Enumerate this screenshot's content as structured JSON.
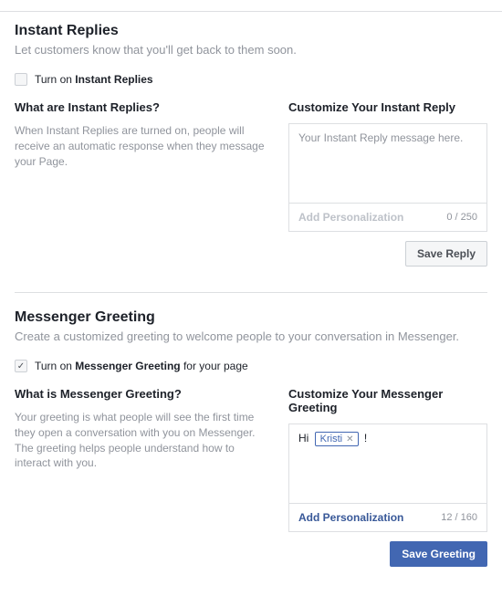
{
  "instant_replies": {
    "title": "Instant Replies",
    "subtitle": "Let customers know that you'll get back to them soon.",
    "checkbox_prefix": "Turn on ",
    "checkbox_bold": "Instant Replies",
    "checked": false,
    "left_heading": "What are Instant Replies?",
    "left_desc": "When Instant Replies are turned on, people will receive an automatic response when they message your Page.",
    "right_heading": "Customize Your Instant Reply",
    "textarea_placeholder": "Your Instant Reply message here.",
    "add_personalization_label": "Add Personalization",
    "char_count": "0 / 250",
    "save_button": "Save Reply"
  },
  "messenger_greeting": {
    "title": "Messenger Greeting",
    "subtitle": "Create a customized greeting to welcome people to your conversation in Messenger.",
    "checkbox_prefix": "Turn on ",
    "checkbox_bold": "Messenger Greeting",
    "checkbox_suffix": " for your page",
    "checked": true,
    "left_heading": "What is Messenger Greeting?",
    "left_desc": "Your greeting is what people will see the first time they open a conversation with you on Messenger. The greeting helps people understand how to interact with you.",
    "right_heading": "Customize Your Messenger Greeting",
    "content_prefix": "Hi ",
    "token_text": "Kristi",
    "content_suffix": " !",
    "add_personalization_label": "Add Personalization",
    "char_count": "12 / 160",
    "save_button": "Save Greeting"
  }
}
